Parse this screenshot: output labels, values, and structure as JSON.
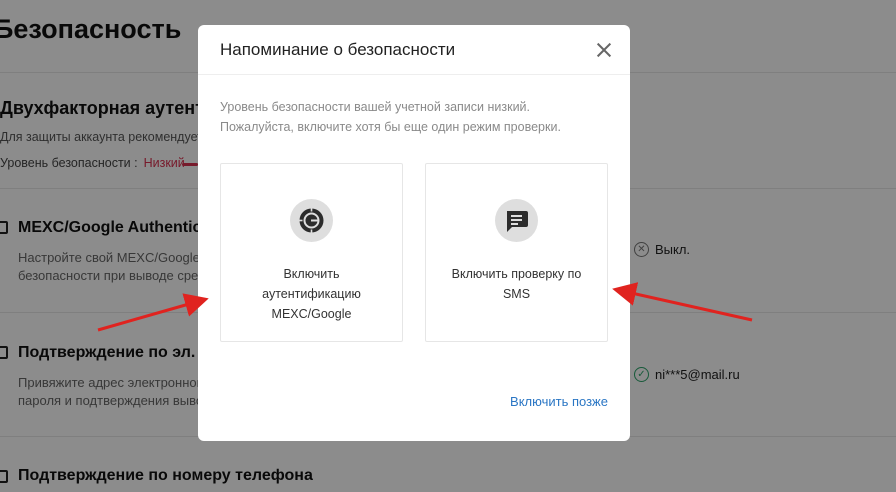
{
  "page": {
    "title": "Безопасность",
    "two_factor": {
      "title": "Двухфакторная аутентификация",
      "subtitle": "Для защиты аккаунта рекомендуется",
      "level_label": "Уровень безопасности :",
      "level_value": "Низкий"
    },
    "items": [
      {
        "title": "MEXC/Google Authenticator",
        "desc_line1": "Настройте свой MEXC/Google Authenticator",
        "desc_line2": "безопасности при выводе средств",
        "status": "Выкл."
      },
      {
        "title": "Подтверждение по эл. почте",
        "desc_line1": "Привяжите адрес электронной почты",
        "desc_line2": "пароля и подтверждения вывода",
        "status": "ni***5@mail.ru"
      },
      {
        "title": "Подтверждение по номеру телефона"
      }
    ]
  },
  "modal": {
    "title": "Напоминание о безопасности",
    "message_line1": "Уровень безопасности вашей учетной записи низкий.",
    "message_line2": "Пожалуйста, включите хотя бы еще один режим проверки.",
    "options": [
      {
        "label_line1": "Включить",
        "label_line2": "аутентификацию",
        "label_line3": "MEXC/Google",
        "icon": "authenticator-icon"
      },
      {
        "label_line1": "Включить проверку по",
        "label_line2": "SMS",
        "icon": "sms-message-icon"
      }
    ],
    "later_label": "Включить позже"
  },
  "colors": {
    "accent_link": "#2a76c4",
    "danger": "#d9304f",
    "success": "#2ca56b",
    "arrow": "#e0231f"
  }
}
